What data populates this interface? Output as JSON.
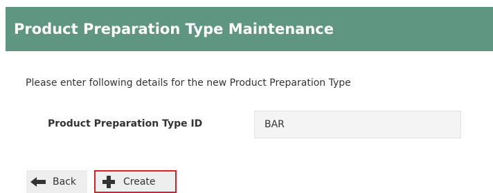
{
  "header": {
    "title": "Product Preparation Type Maintenance"
  },
  "form": {
    "intro": "Please enter following details for the new Product Preparation Type",
    "id_label": "Product Preparation Type ID",
    "id_value": "BAR"
  },
  "actions": {
    "back_label": "Back",
    "create_label": "Create"
  },
  "colors": {
    "header_bg": "#5f9682",
    "button_bg": "#eeeeee",
    "highlight": "#e11d24"
  },
  "icons": {
    "back": "arrow-left-icon",
    "create": "plus-icon"
  }
}
